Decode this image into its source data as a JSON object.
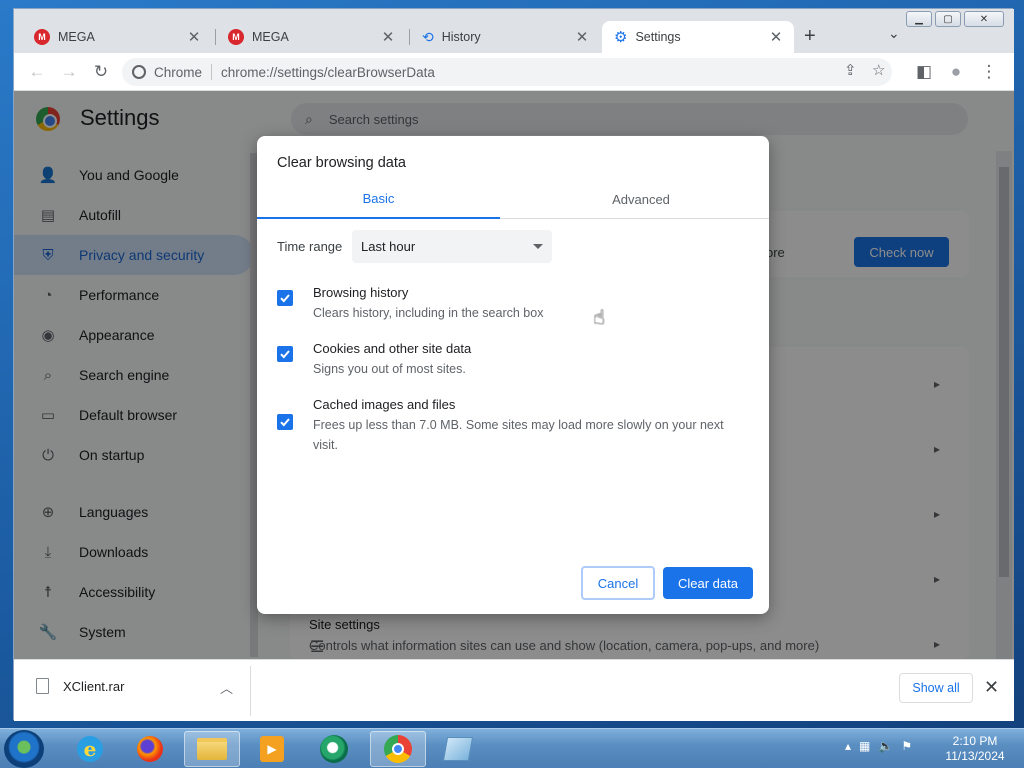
{
  "window": {
    "controls": [
      "▭",
      "▫",
      "✕"
    ]
  },
  "tabs": [
    {
      "title": "MEGA",
      "icon": "mega-icon",
      "close": "✕"
    },
    {
      "title": "MEGA",
      "icon": "mega-icon",
      "close": "✕"
    },
    {
      "title": "History",
      "icon": "history-icon",
      "close": "✕"
    },
    {
      "title": "Settings",
      "icon": "gear-icon",
      "close": "✕",
      "active": true
    }
  ],
  "toolbar": {
    "back": "←",
    "forward": "→",
    "reload": "↻",
    "site_chip": "Chrome",
    "url": "chrome://settings/clearBrowserData",
    "share": "⇪",
    "bookmark": "☆",
    "side_panel": "◧",
    "profile": "●",
    "menu": "⋮",
    "new_tab": "+",
    "tab_list": "⌄"
  },
  "settings": {
    "title": "Settings",
    "search_placeholder": "Search settings",
    "sidebar": [
      {
        "label": "You and Google",
        "icon": "person-icon"
      },
      {
        "label": "Autofill",
        "icon": "clipboard-icon"
      },
      {
        "label": "Privacy and security",
        "icon": "shield-icon",
        "active": true
      },
      {
        "label": "Performance",
        "icon": "gauge-icon"
      },
      {
        "label": "Appearance",
        "icon": "palette-icon"
      },
      {
        "label": "Search engine",
        "icon": "search-icon"
      },
      {
        "label": "Default browser",
        "icon": "browser-icon"
      },
      {
        "label": "On startup",
        "icon": "power-icon"
      },
      {
        "label": "Languages",
        "icon": "globe-icon"
      },
      {
        "label": "Downloads",
        "icon": "download-icon"
      },
      {
        "label": "Accessibility",
        "icon": "accessibility-icon"
      },
      {
        "label": "System",
        "icon": "wrench-icon"
      }
    ],
    "safety_check_more": "ore",
    "check_now": "Check now",
    "site_settings_title": "Site settings",
    "site_settings_sub": "Controls what information sites can use and show (location, camera, pop-ups, and more)"
  },
  "dialog": {
    "title": "Clear browsing data",
    "tabs": [
      "Basic",
      "Advanced"
    ],
    "time_range_label": "Time range",
    "time_range_value": "Last hour",
    "options": [
      {
        "title": "Browsing history",
        "sub": "Clears history, including in the search box",
        "checked": true
      },
      {
        "title": "Cookies and other site data",
        "sub": "Signs you out of most sites.",
        "checked": true
      },
      {
        "title": "Cached images and files",
        "sub": "Frees up less than 7.0 MB. Some sites may load more slowly on your next visit.",
        "checked": true
      }
    ],
    "cancel": "Cancel",
    "clear": "Clear data"
  },
  "downloads": {
    "file": "XClient.rar",
    "show_all": "Show all",
    "close": "✕"
  },
  "taskbar": {
    "time": "2:10 PM",
    "date": "11/13/2024"
  },
  "colors": {
    "accent": "#1a73e8",
    "sidebar_active_bg": "#d2e3fc"
  }
}
